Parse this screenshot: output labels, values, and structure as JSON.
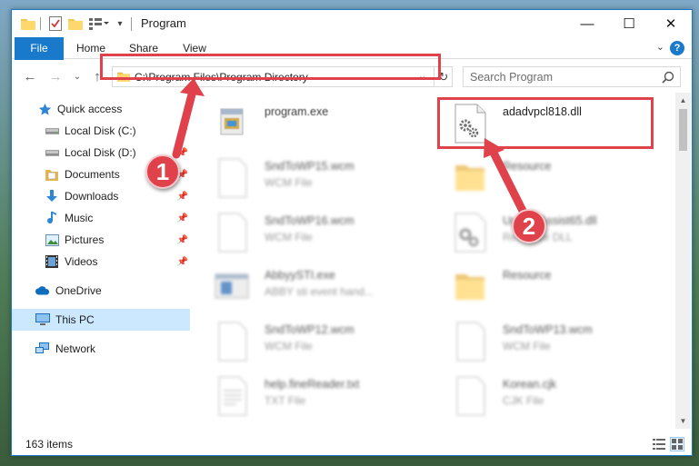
{
  "window": {
    "title": "Program",
    "buttons": {
      "minimize": "—",
      "maximize": "☐",
      "close": "✕"
    }
  },
  "ribbon": {
    "tabs": [
      "File",
      "Home",
      "Share",
      "View"
    ],
    "help": "?",
    "collapse": "⌄"
  },
  "address": {
    "path": "C:\\Program Files\\Program Directory",
    "dropdown": "⌄",
    "refresh": "↻"
  },
  "search": {
    "placeholder": "Search Program",
    "icon": "search-icon"
  },
  "nav": {
    "back": "←",
    "forward": "→",
    "recent": "⌄",
    "up": "↑"
  },
  "sidebar": {
    "items": [
      {
        "label": "Quick access",
        "icon": "star-icon",
        "pinned": false
      },
      {
        "label": "Local Disk (C:)",
        "icon": "drive-icon",
        "pinned": true
      },
      {
        "label": "Local Disk (D:)",
        "icon": "drive-icon",
        "pinned": true
      },
      {
        "label": "Documents",
        "icon": "documents-icon",
        "pinned": true
      },
      {
        "label": "Downloads",
        "icon": "download-icon",
        "pinned": true
      },
      {
        "label": "Music",
        "icon": "music-icon",
        "pinned": true
      },
      {
        "label": "Pictures",
        "icon": "pictures-icon",
        "pinned": true
      },
      {
        "label": "Videos",
        "icon": "videos-icon",
        "pinned": true
      },
      {
        "label": "OneDrive",
        "icon": "cloud-icon",
        "pinned": false
      },
      {
        "label": "This PC",
        "icon": "computer-icon",
        "pinned": false,
        "selected": true
      },
      {
        "label": "Network",
        "icon": "network-icon",
        "pinned": false
      }
    ]
  },
  "files": [
    {
      "name": "program.exe",
      "type": "",
      "icon": "exe-icon"
    },
    {
      "name": "adadvpcl818.dll",
      "type": "",
      "icon": "dll-icon"
    },
    {
      "name": "SndToWP15.wcm",
      "type": "WCM File",
      "icon": "file-icon"
    },
    {
      "name": "Resource",
      "type": "",
      "icon": "folder-icon"
    },
    {
      "name": "SndToWP16.wcm",
      "type": "WCM File",
      "icon": "file-icon"
    },
    {
      "name": "UpdateAssist65.dll",
      "type": "Resource DLL",
      "icon": "dll-icon"
    },
    {
      "name": "AbbyySTI.exe",
      "type": "ABBY sti event hand...",
      "icon": "exe-icon"
    },
    {
      "name": "Resource",
      "type": "",
      "icon": "folder-icon"
    },
    {
      "name": "SndToWP12.wcm",
      "type": "WCM File",
      "icon": "file-icon"
    },
    {
      "name": "SndToWP13.wcm",
      "type": "WCM File",
      "icon": "file-icon"
    },
    {
      "name": "help.fineReader.txt",
      "type": "TXT File",
      "icon": "text-file-icon"
    },
    {
      "name": "Korean.cjk",
      "type": "CJK File",
      "icon": "file-icon"
    }
  ],
  "status": {
    "count": "163 items"
  },
  "annotations": {
    "step1": "1",
    "step2": "2"
  },
  "colors": {
    "accent": "#1979ca",
    "highlight": "#e0424c",
    "selected": "#cce8ff"
  }
}
